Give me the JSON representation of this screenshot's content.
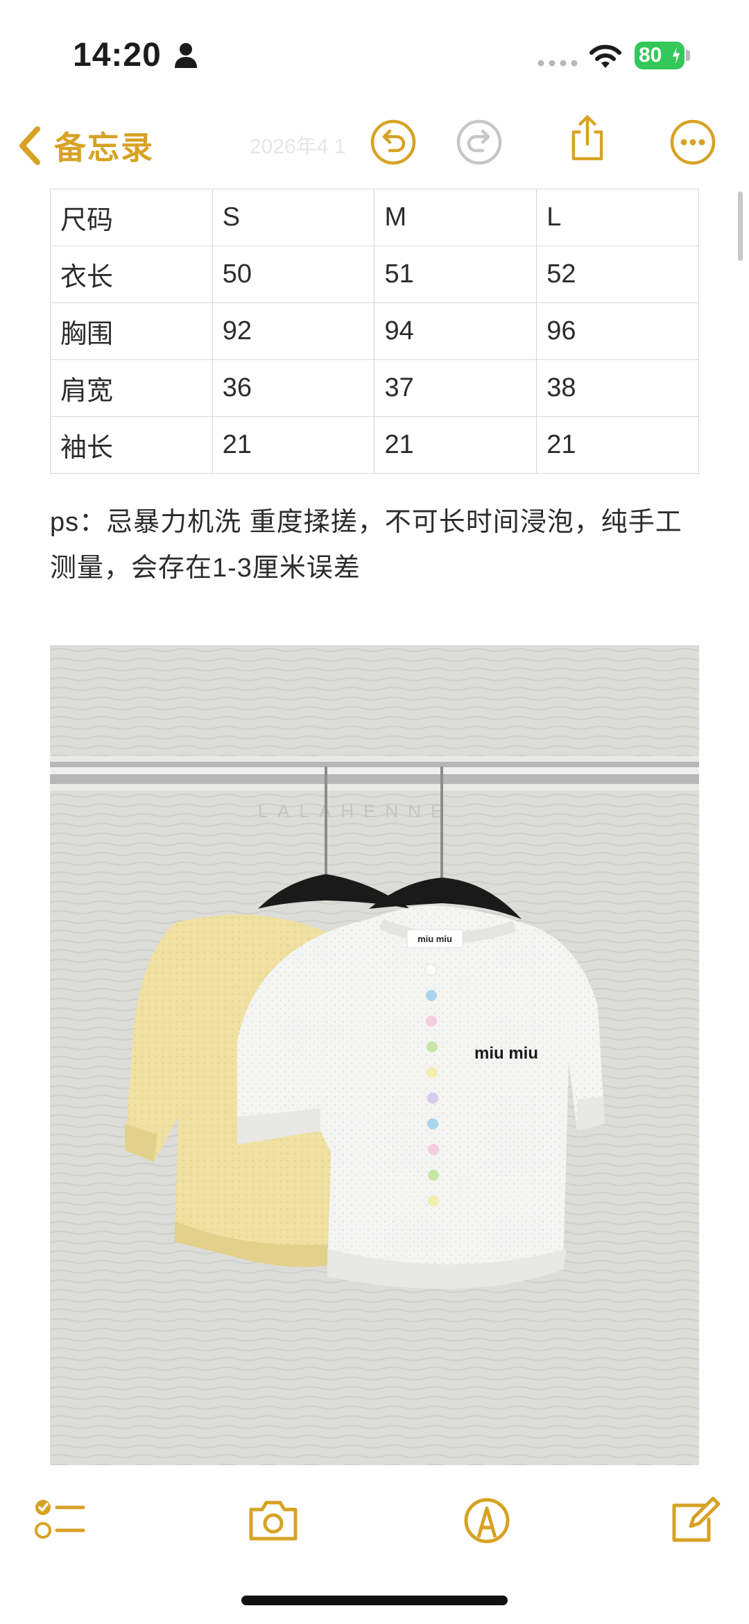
{
  "status_bar": {
    "time": "14:20",
    "battery_level": "80",
    "battery_color": "#34c759",
    "icons": [
      "person-icon",
      "signal-dots-icon",
      "wifi-icon",
      "battery-icon",
      "charging-bolt-icon"
    ]
  },
  "nav": {
    "back_label": "备忘录",
    "date_partial": "2026年4 1",
    "accent_color": "#d7a224",
    "icons": [
      "chevron-left-icon",
      "undo-icon",
      "redo-icon",
      "share-icon",
      "more-icon"
    ]
  },
  "size_table": {
    "rows": [
      [
        "尺码",
        "S",
        "M",
        "L"
      ],
      [
        "衣长",
        "50",
        "51",
        "52"
      ],
      [
        "胸围",
        "92",
        "94",
        "96"
      ],
      [
        "肩宽",
        "36",
        "37",
        "38"
      ],
      [
        "袖长",
        "21",
        "21",
        "21"
      ]
    ]
  },
  "note": {
    "text": "ps：忌暴力机洗 重度揉搓，不可长时间浸泡，纯手工测量，会存在1-3厘米误差"
  },
  "photo": {
    "watermark": "LALAHENNE",
    "brand_label": "miu miu",
    "neck_label": "miu miu"
  },
  "toolbar": {
    "icons": [
      "checklist-icon",
      "camera-icon",
      "markup-icon",
      "compose-icon"
    ]
  }
}
